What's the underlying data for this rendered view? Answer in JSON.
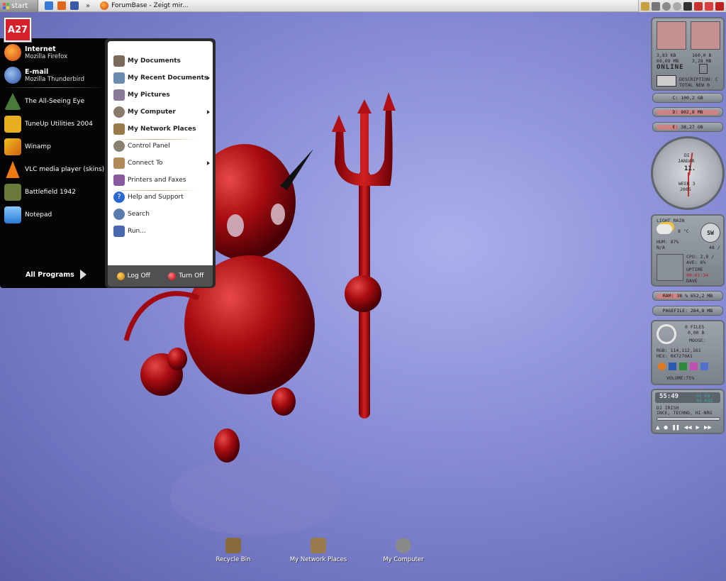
{
  "taskbar": {
    "start_label": "start",
    "more_label": "»",
    "window_title": "ForumBase - Zeigt mir..."
  },
  "start_menu": {
    "user_tile": "A27",
    "pinned": [
      {
        "title": "Internet",
        "subtitle": "Mozilla Firefox",
        "icon": "firefox-icon",
        "color": "#e66a1a"
      },
      {
        "title": "E-mail",
        "subtitle": "Mozilla Thunderbird",
        "icon": "thunderbird-icon",
        "color": "#3a6ac8"
      }
    ],
    "recent": [
      {
        "label": "The All-Seeing Eye",
        "icon": "all-seeing-eye-icon",
        "color": "#4a7a3a"
      },
      {
        "label": "TuneUp Utilities 2004",
        "icon": "tuneup-icon",
        "color": "#e8b020"
      },
      {
        "label": "Winamp",
        "icon": "winamp-icon",
        "color": "#e8a020"
      },
      {
        "label": "VLC media player (skins)",
        "icon": "vlc-icon",
        "color": "#f07a10"
      },
      {
        "label": "Battlefield 1942",
        "icon": "battlefield-icon",
        "color": "#6a7a3a"
      },
      {
        "label": "Notepad",
        "icon": "notepad-icon",
        "color": "#4a9ae0"
      }
    ],
    "all_programs": "All Programs",
    "places": [
      {
        "label": "My Documents",
        "bold": true,
        "arrow": false,
        "icon": "documents-icon",
        "color": "#7a6a5a"
      },
      {
        "label": "My Recent Documents",
        "bold": true,
        "arrow": true,
        "icon": "recent-documents-icon",
        "color": "#6a8ab0"
      },
      {
        "label": "My Pictures",
        "bold": true,
        "arrow": false,
        "icon": "pictures-icon",
        "color": "#8a7a9a"
      },
      {
        "label": "My Computer",
        "bold": true,
        "arrow": true,
        "icon": "computer-icon",
        "color": "#8a7a6a"
      },
      {
        "label": "My Network Places",
        "bold": true,
        "arrow": false,
        "icon": "network-icon",
        "color": "#9a7a4a"
      },
      {
        "label": "Control Panel",
        "bold": false,
        "arrow": false,
        "icon": "control-panel-icon",
        "color": "#8a8070"
      },
      {
        "label": "Connect To",
        "bold": false,
        "arrow": true,
        "icon": "connect-icon",
        "color": "#b08a5a"
      },
      {
        "label": "Printers and Faxes",
        "bold": false,
        "arrow": false,
        "icon": "printer-icon",
        "color": "#8a5aa0"
      },
      {
        "label": "Help and Support",
        "bold": false,
        "arrow": false,
        "icon": "help-icon",
        "color": "#2a6ad0"
      },
      {
        "label": "Search",
        "bold": false,
        "arrow": false,
        "icon": "search-icon",
        "color": "#5a7ab0"
      },
      {
        "label": "Run...",
        "bold": false,
        "arrow": false,
        "icon": "run-icon",
        "color": "#4a6ab0"
      }
    ],
    "log_off": "Log Off",
    "turn_off": "Turn Off"
  },
  "desktop_icons": [
    {
      "label": "Recycle Bin",
      "icon": "recycle-bin-icon",
      "color": "#8a6a3a"
    },
    {
      "label": "My Network Places",
      "icon": "network-icon",
      "color": "#9a7a4a"
    },
    {
      "label": "My Computer",
      "icon": "computer-icon",
      "color": "#8a8a8a"
    }
  ],
  "widgets": {
    "net_down": "3,83 KB",
    "net_down_total": "69,69 MB",
    "net_up": "160,0 B",
    "net_up_total": "3,28 MB",
    "online": "ONLINE",
    "mail_desc": "DESCRIPTION: C",
    "mail_total": "TOTAL NEW 0",
    "drive_c": "C: 100,2 GB",
    "drive_d": "D: 802,8 MB",
    "drive_e": "E: 38,27 GB",
    "clock_day": "DI",
    "clock_month": "JANUAR",
    "clock_date": "11.",
    "clock_week": "WEEK 3",
    "clock_year": "2005",
    "weather_cond": "LIGHT RAIN",
    "weather_temp": "8 °C",
    "weather_hum": "HUM: 87%",
    "weather_na": "N/A",
    "wind_dir": "SW",
    "wind_speed": "48 /",
    "cpu": "CPU: 2,0 /",
    "cpu_ave": "AVE: 6%",
    "uptime_label": "UPTIME",
    "uptime": "00:01:34",
    "user": "DAVE",
    "ram": "RAM: 38 %  652,2 MB",
    "ram_pct": 38,
    "pagefile": "PAGEFILE: 284,8 MB",
    "files": "0 FILES",
    "files_size": "0,00 B",
    "mouse": "MOUSE:",
    "rgb": "RGB: 114,112,161",
    "hex": "HEX: 0X7270A1",
    "volume": "VOLUME:75%",
    "mp_time": "55:49",
    "mp_kbs": "55 KB",
    "mp_khz": "44 KHZ",
    "mp_artist": "DJ IRISH",
    "mp_genre": "INCE, TECHNO, HI-NRG"
  }
}
